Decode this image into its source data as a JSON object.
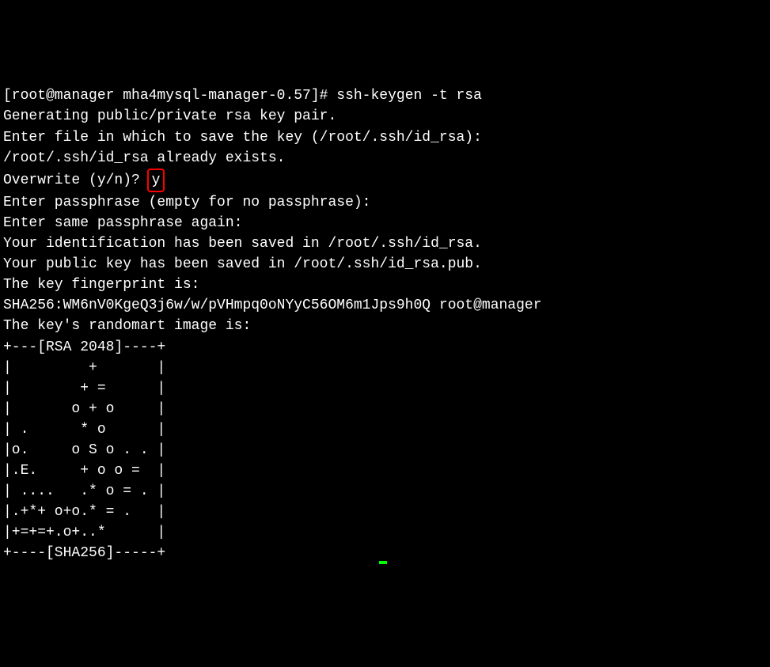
{
  "terminal": {
    "prompt": "[root@manager mha4mysql-manager-0.57]# ",
    "command": "ssh-keygen -t rsa",
    "lines": {
      "l1": "Generating public/private rsa key pair.",
      "l2": "Enter file in which to save the key (/root/.ssh/id_rsa):",
      "l3": "/root/.ssh/id_rsa already exists.",
      "l4_prefix": "Overwrite (y/n)? ",
      "l4_input": "y",
      "l5": "Enter passphrase (empty for no passphrase):",
      "l6": "Enter same passphrase again:",
      "l7": "Your identification has been saved in /root/.ssh/id_rsa.",
      "l8": "Your public key has been saved in /root/.ssh/id_rsa.pub.",
      "l9": "The key fingerprint is:",
      "l10": "SHA256:WM6nV0KgeQ3j6w/w/pVHmpq0oNYyC56OM6m1Jps9h0Q root@manager",
      "l11": "The key's randomart image is:",
      "r1": "+---[RSA 2048]----+",
      "r2": "|         +       |",
      "r3": "|        + =      |",
      "r4": "|       o + o     |",
      "r5": "| .      * o      |",
      "r6": "|o.     o S o . . |",
      "r7": "|.E.     + o o =  |",
      "r8": "| ....   .* o = . |",
      "r9": "|.+*+ o+o.* = .   |",
      "r10": "|+=+=+.o+..*      |",
      "r11": "+----[SHA256]-----+"
    }
  }
}
